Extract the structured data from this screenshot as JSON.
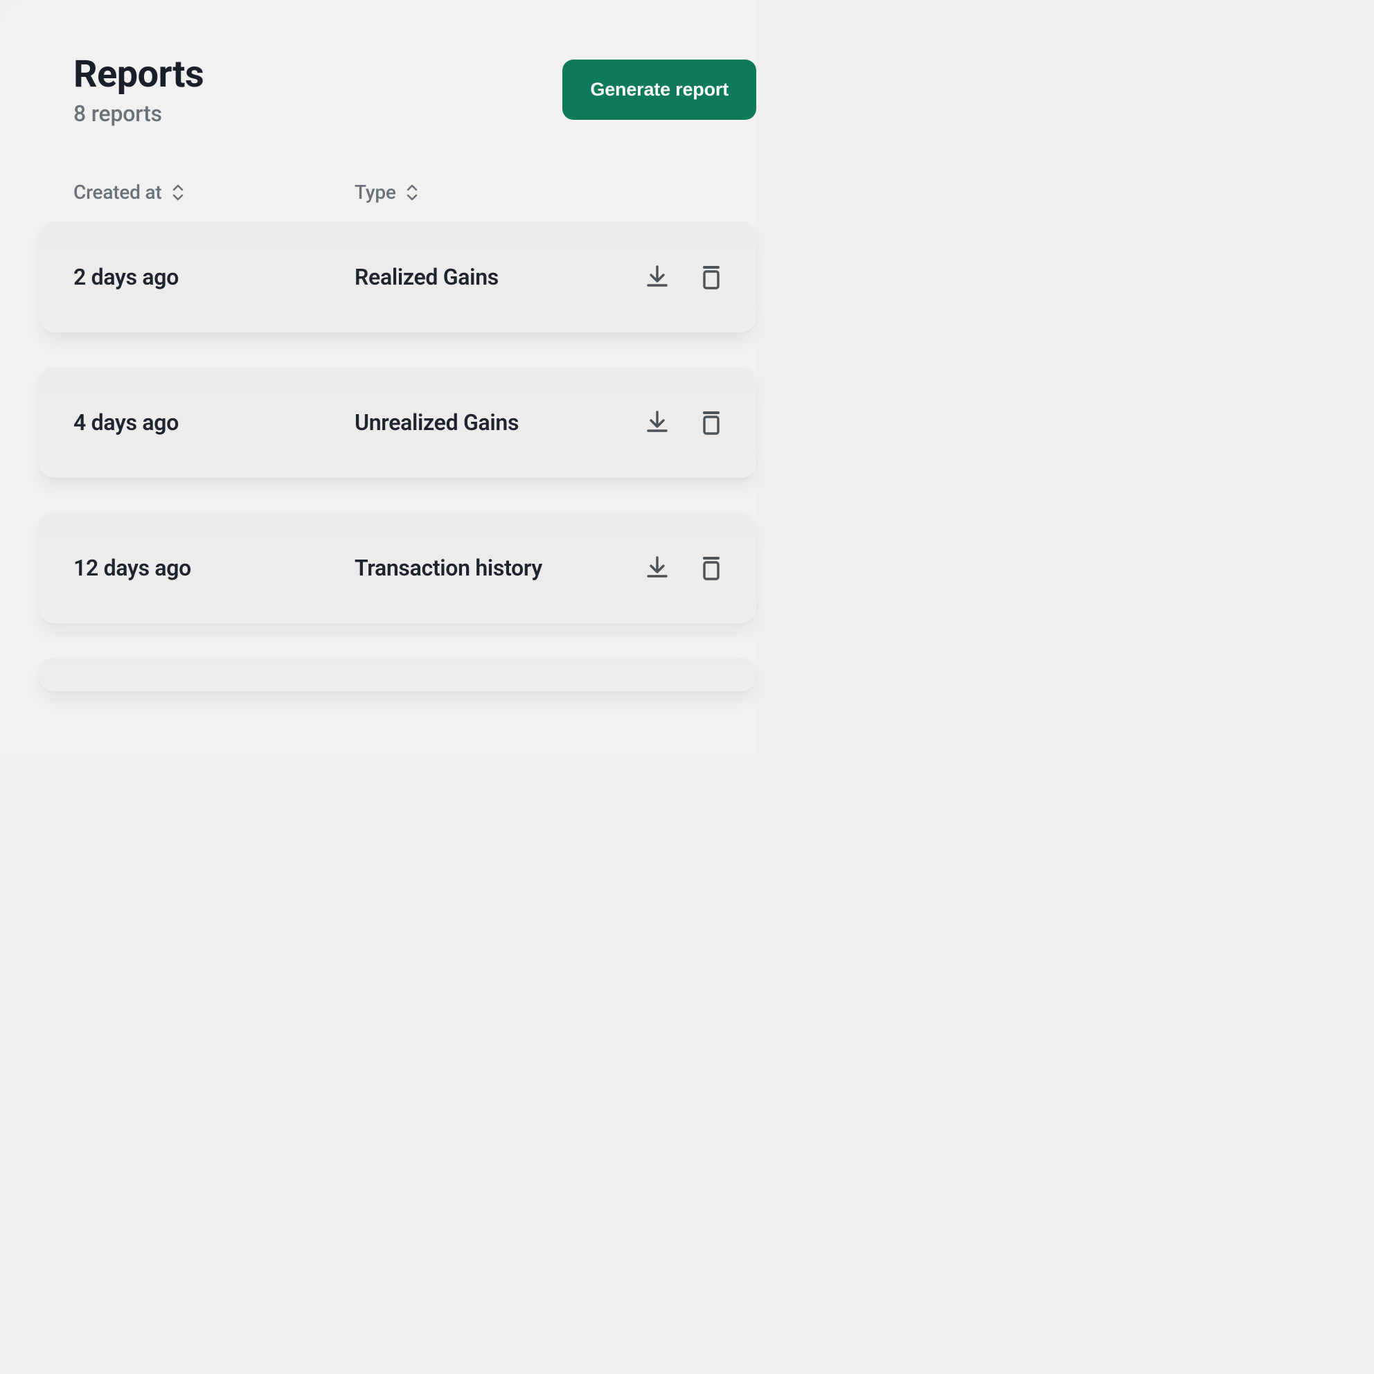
{
  "header": {
    "title": "Reports",
    "subtitle": "8 reports",
    "generate_label": "Generate report"
  },
  "columns": {
    "created_at": "Created at",
    "type": "Type"
  },
  "rows": [
    {
      "created_at": "2 days ago",
      "type": "Realized Gains"
    },
    {
      "created_at": "4 days ago",
      "type": "Unrealized Gains"
    },
    {
      "created_at": "12 days ago",
      "type": "Transaction history"
    }
  ],
  "colors": {
    "primary_button": "#0f7a5a",
    "text_dark": "#1f2430",
    "text_muted": "#6b7178",
    "icon": "#4d5257"
  }
}
